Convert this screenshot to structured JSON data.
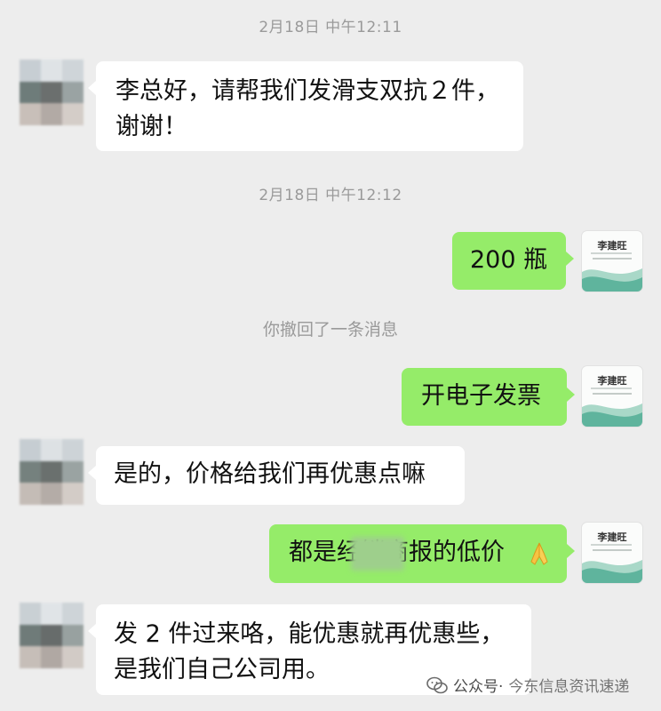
{
  "chat": {
    "timestamps": [
      "2月18日 中午12:11",
      "2月18日 中午12:12"
    ],
    "recall_notice": "你撤回了一条消息",
    "self_avatar_name": "李建旺",
    "messages": [
      {
        "side": "in",
        "text": "李总好，请帮我们发滑支双抗２件，",
        "text2": "谢谢！"
      },
      {
        "side": "out",
        "text": "200 瓶"
      },
      {
        "side": "out",
        "text": "开电子发票"
      },
      {
        "side": "in",
        "text": "是的，价格给我们再优惠点嘛"
      },
      {
        "side": "out",
        "text": "都是经销商报的低价",
        "emoji": "folded-hands-icon"
      },
      {
        "side": "in",
        "text": "发 2 件过来咯，能优惠就再优惠些，",
        "text2": "是我们自己公司用。"
      }
    ]
  },
  "watermark": {
    "prefix": "公众号·",
    "source": "今东信息资讯速递"
  },
  "colors": {
    "background": "#ededed",
    "incoming_bubble": "#ffffff",
    "outgoing_bubble": "#95ec69",
    "timestamp_text": "#9a9a9a"
  }
}
